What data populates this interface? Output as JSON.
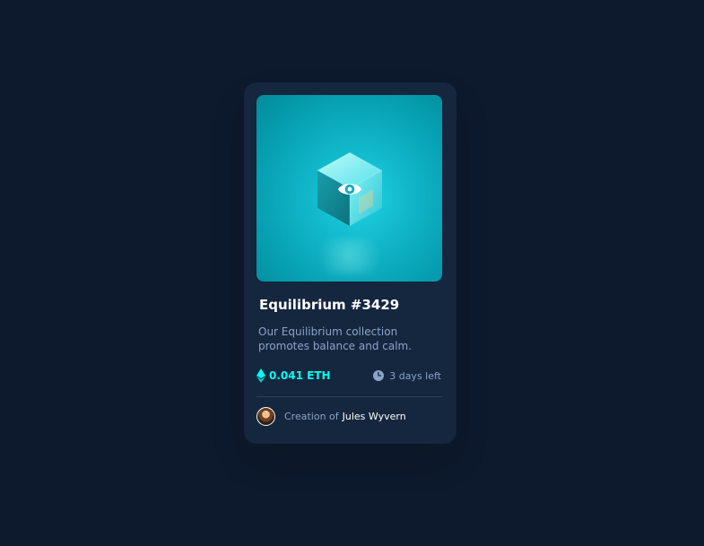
{
  "card": {
    "title": "Equilibrium #3429",
    "description": "Our Equilibrium collection promotes balance and calm.",
    "price": "0.041 ETH",
    "days_left": "3 days left",
    "creation_label": "Creation of",
    "creator_name": "Jules Wyvern"
  },
  "icons": {
    "eye": "eye-icon",
    "ethereum": "ethereum-icon",
    "clock": "clock-icon",
    "avatar": "avatar"
  },
  "colors": {
    "background": "#0d192c",
    "card": "#15263f",
    "accent": "#00fff0",
    "muted": "#8aa4c8",
    "white": "#ffffff",
    "divider": "#2e405a"
  }
}
